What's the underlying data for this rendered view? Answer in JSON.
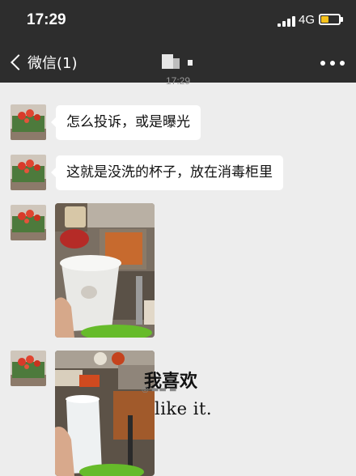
{
  "status_bar": {
    "time": "17:29",
    "network": "4G",
    "battery_level": 0.45,
    "battery_color": "#f7c21b"
  },
  "nav": {
    "back_label": "微信(1)",
    "back_icon": "chevron-left-icon",
    "more_icon": "more-dots-icon"
  },
  "chat": {
    "timestamp": "17:29",
    "messages": [
      {
        "type": "text",
        "text": "怎么投诉，或是曝光"
      },
      {
        "type": "text",
        "text": "这就是没洗的杯子，放在消毒柜里"
      },
      {
        "type": "image",
        "subject": "dirty cup held over hotpot table"
      },
      {
        "type": "image",
        "subject": "plastic cup on hotpot restaurant table"
      }
    ]
  },
  "watermark": {
    "text_cn": "我喜欢",
    "text_en": "like it."
  },
  "colors": {
    "header_bg": "#2d2d2d",
    "chat_bg": "#ededed",
    "bubble_bg": "#ffffff"
  }
}
